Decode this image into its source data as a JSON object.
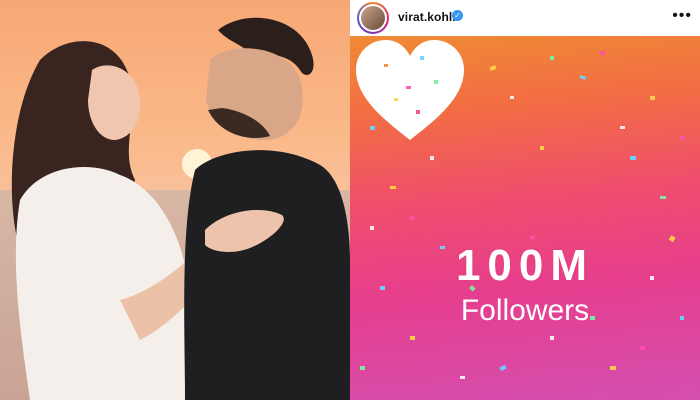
{
  "profile": {
    "username": "virat.kohli",
    "verified_icon": "verified-badge-icon",
    "more_icon": "more-options-icon"
  },
  "milestone": {
    "count": "100M",
    "label": "Followers"
  },
  "colors": {
    "gradient_top": "#f08a34",
    "gradient_bottom": "#d44fb0",
    "verified": "#3897f0"
  }
}
